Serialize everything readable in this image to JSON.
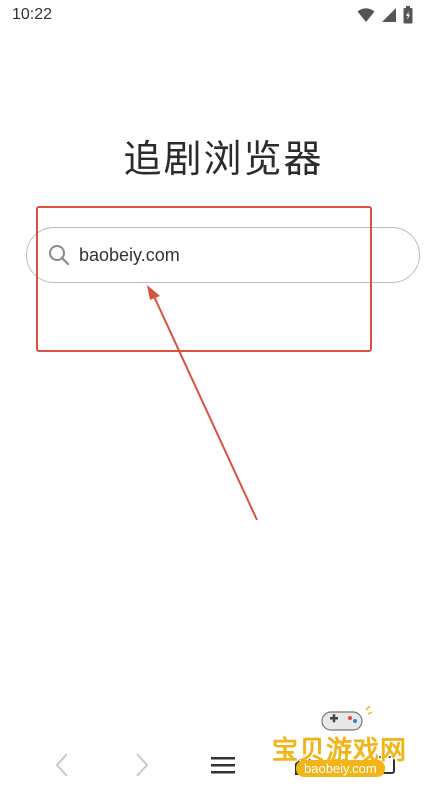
{
  "status_bar": {
    "time": "10:22",
    "icons": [
      "wifi-icon",
      "signal-icon",
      "battery-icon"
    ]
  },
  "app": {
    "title": "追剧浏览器"
  },
  "search": {
    "value": "baobeiy.com",
    "icon": "search-icon"
  },
  "bottom_nav": {
    "items": [
      {
        "name": "back",
        "icon": "chevron-left-icon"
      },
      {
        "name": "forward",
        "icon": "chevron-right-icon"
      },
      {
        "name": "menu",
        "icon": "hamburger-menu-icon"
      },
      {
        "name": "home",
        "icon": "home-icon"
      },
      {
        "name": "tabs",
        "icon": "tabs-icon"
      }
    ]
  },
  "watermark": {
    "text": "宝贝游戏网",
    "url": "baobeiy.com"
  },
  "colors": {
    "annotation": "#d9513f",
    "nav_icon": "#c9c9c9",
    "watermark": "#f2b418"
  }
}
